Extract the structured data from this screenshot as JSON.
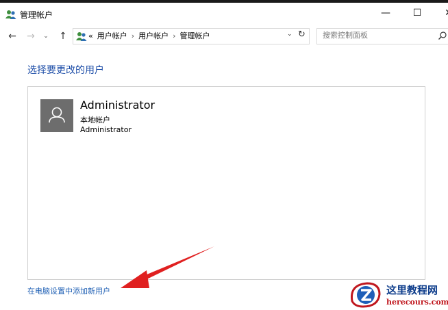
{
  "window": {
    "title": "管理帐户",
    "minimize_glyph": "—",
    "maximize_glyph": "☐",
    "close_glyph": "✕"
  },
  "nav": {
    "back_glyph": "←",
    "forward_glyph": "→",
    "recent_glyph": "⌄",
    "up_glyph": "↑",
    "breadcrumb_overflow": "«",
    "breadcrumbs": [
      "用户帐户",
      "用户帐户",
      "管理帐户"
    ],
    "breadcrumb_sep": "›",
    "dropdown_glyph": "⌄",
    "refresh_glyph": "↻"
  },
  "search": {
    "placeholder": "搜索控制面板"
  },
  "main": {
    "heading": "选择要更改的用户",
    "users": [
      {
        "name": "Administrator",
        "type": "本地帐户",
        "group": "Administrator"
      }
    ],
    "add_user_link": "在电脑设置中添加新用户"
  },
  "watermark": {
    "title": "这里教程网",
    "url": "herecours.com"
  },
  "colors": {
    "heading": "#1e4ea8",
    "link": "#1e5fb4",
    "avatar_bg": "#6d6d6d",
    "arrow": "#e02020",
    "panel_border": "#cfcfcf"
  },
  "icons": {
    "app": "users-group-icon",
    "avatar": "user-silhouette-icon",
    "search": "magnifier-icon",
    "annotation": "red-arrow"
  }
}
